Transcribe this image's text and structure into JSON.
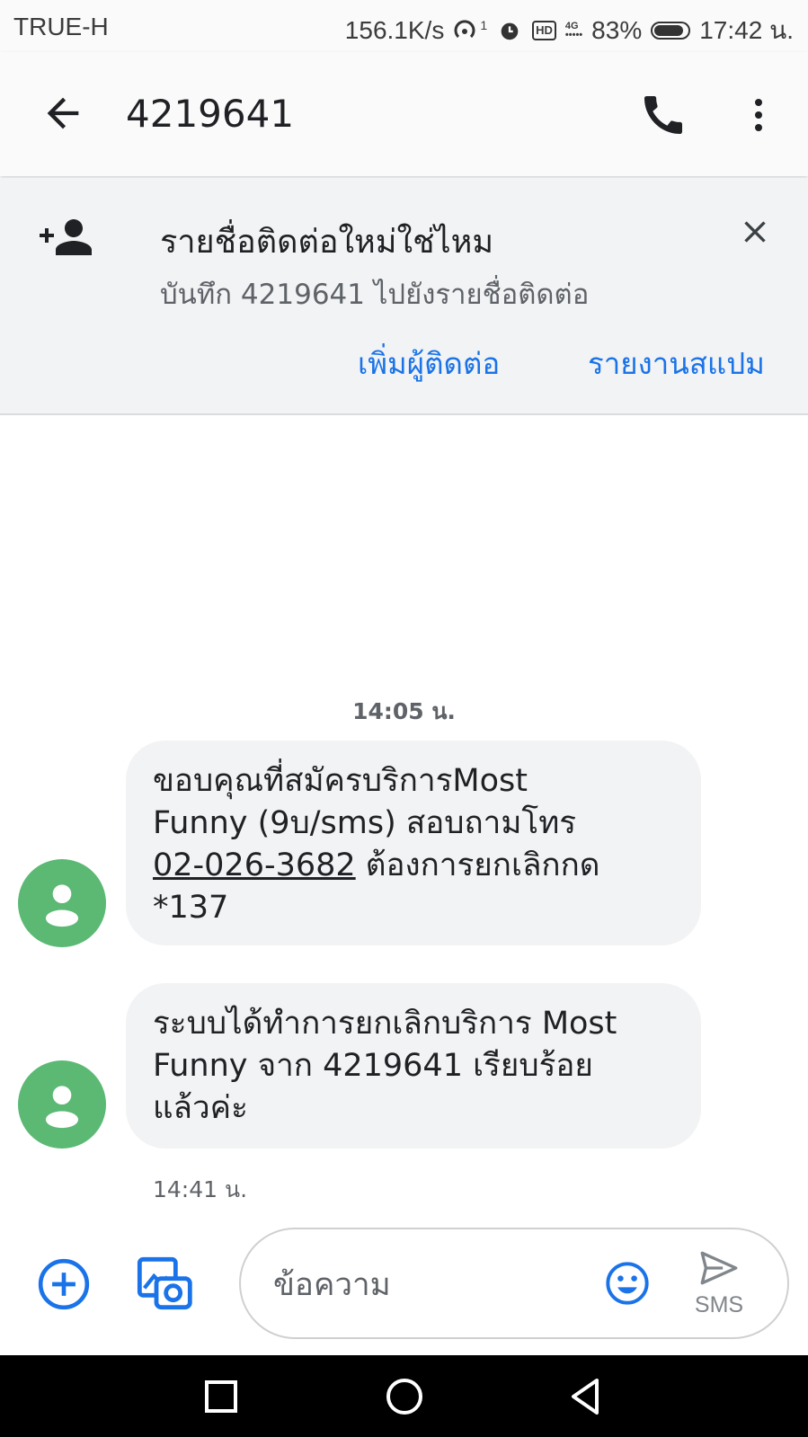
{
  "status_bar": {
    "carrier": "TRUE-H",
    "speed": "156.1K/s",
    "hotspot_count": "1",
    "network": "4G",
    "battery": "83%",
    "time": "17:42 น."
  },
  "app_bar": {
    "title": "4219641",
    "icons": [
      "back-arrow-icon",
      "phone-icon",
      "more-vert-icon"
    ]
  },
  "banner": {
    "title": "รายชื่อติดต่อใหม่ใช่ไหม",
    "subtitle": "บันทึก 4219641 ไปยังรายชื่อติดต่อ",
    "add_contact_label": "เพิ่มผู้ติดต่อ",
    "report_spam_label": "รายงานสแปม"
  },
  "conversation": {
    "top_timestamp": "14:05 น.",
    "messages": [
      {
        "line1": "ขอบคุณที่สมัครบริการMost",
        "line2": "Funny (9บ/sms) สอบถามโทร",
        "phone": "02-026-3682",
        "line3_rest": " ต้องการยกเลิกกด",
        "line4": "*137"
      },
      {
        "line1": "ระบบได้ทำการยกเลิกบริการ Most",
        "line2": "Funny จาก 4219641 เรียบร้อย",
        "line3": "แล้วค่ะ"
      }
    ],
    "last_timestamp": "14:41 น."
  },
  "composer": {
    "placeholder": "ข้อความ",
    "send_label": "SMS"
  },
  "colors": {
    "accent": "#1a73e8",
    "avatar": "#5bb974",
    "bubble": "#f1f3f4"
  }
}
